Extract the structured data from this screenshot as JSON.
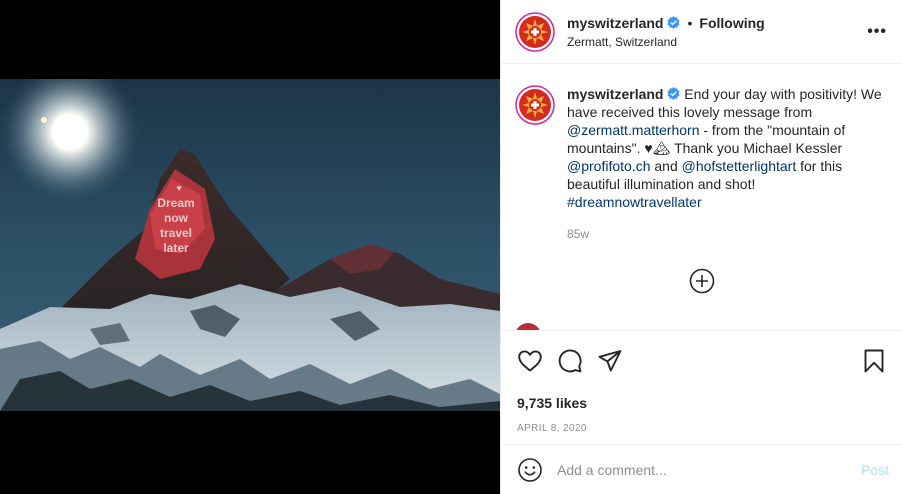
{
  "post": {
    "username": "myswitzerland",
    "following_label": "Following",
    "location": "Zermatt, Switzerland",
    "more_label": "•••",
    "image_text": [
      "Dream",
      "now",
      "travel",
      "later"
    ]
  },
  "caption": {
    "username": "myswitzerland",
    "text_1": "End your day with positivity! We have received this lovely message from ",
    "mention_1": "@zermatt.matterhorn",
    "text_2": " - from the \"mountain of mountains\". ♥🏔 Thank you Michael Kessler ",
    "mention_2": "@profifoto.ch",
    "text_3": " and ",
    "mention_3": "@hofstetterlightart",
    "text_4": " for this beautiful illumination and shot! ",
    "hashtag": "#dreamnowtravellater",
    "time": "85w"
  },
  "engagement": {
    "likes": "9,735 likes",
    "date": "APRIL 8, 2020"
  },
  "comment_box": {
    "placeholder": "Add a comment...",
    "post_label": "Post"
  },
  "colors": {
    "verified": "#3897f0",
    "link": "#00376b",
    "muted": "#8e8e8e",
    "post_disabled": "#b2dffc",
    "brand_red": "#d52b1e"
  },
  "icons": {
    "like": "heart-icon",
    "comment": "comment-icon",
    "share": "share-icon",
    "save": "bookmark-icon",
    "emoji": "emoji-icon",
    "load_more": "plus-circle-icon",
    "verified": "verified-badge-icon"
  }
}
